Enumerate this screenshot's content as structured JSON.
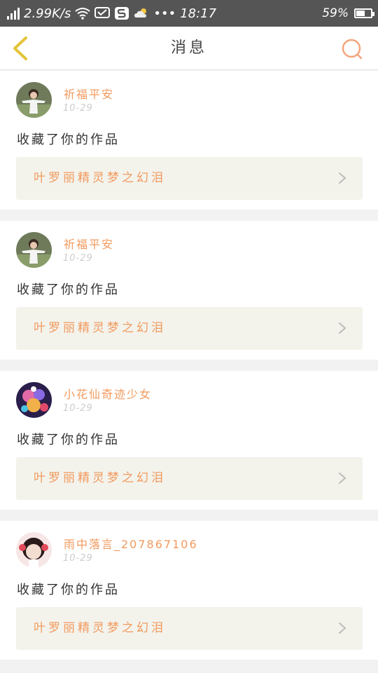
{
  "status_bar": {
    "net_speed": "2.99K/s",
    "time": "18:17",
    "dots": "•••",
    "battery": "59%",
    "battery_level": 0.59,
    "icons": [
      "signal-icon",
      "wifi-icon",
      "message-icon",
      "s-app-icon",
      "weather-icon",
      "battery-icon"
    ]
  },
  "navbar": {
    "title": "消息",
    "icons": [
      "back-chevron-icon",
      "search-icon"
    ]
  },
  "colors": {
    "accent": "#f29a5e",
    "back_icon": "#e4c43a",
    "search_icon": "#f3a57a",
    "status_bg": "#555555"
  },
  "messages": [
    {
      "user": "祈福平安",
      "date": "10-29",
      "action": "收藏了你的作品",
      "work_title": "叶罗丽精灵梦之幻泪"
    },
    {
      "user": "祈福平安",
      "date": "10-29",
      "action": "收藏了你的作品",
      "work_title": "叶罗丽精灵梦之幻泪"
    },
    {
      "user": "小花仙奇迹少女",
      "date": "10-29",
      "action": "收藏了你的作品",
      "work_title": "叶罗丽精灵梦之幻泪"
    },
    {
      "user": "雨中落言_207867106",
      "date": "10-29",
      "action": "收藏了你的作品",
      "work_title": "叶罗丽精灵梦之幻泪"
    }
  ]
}
